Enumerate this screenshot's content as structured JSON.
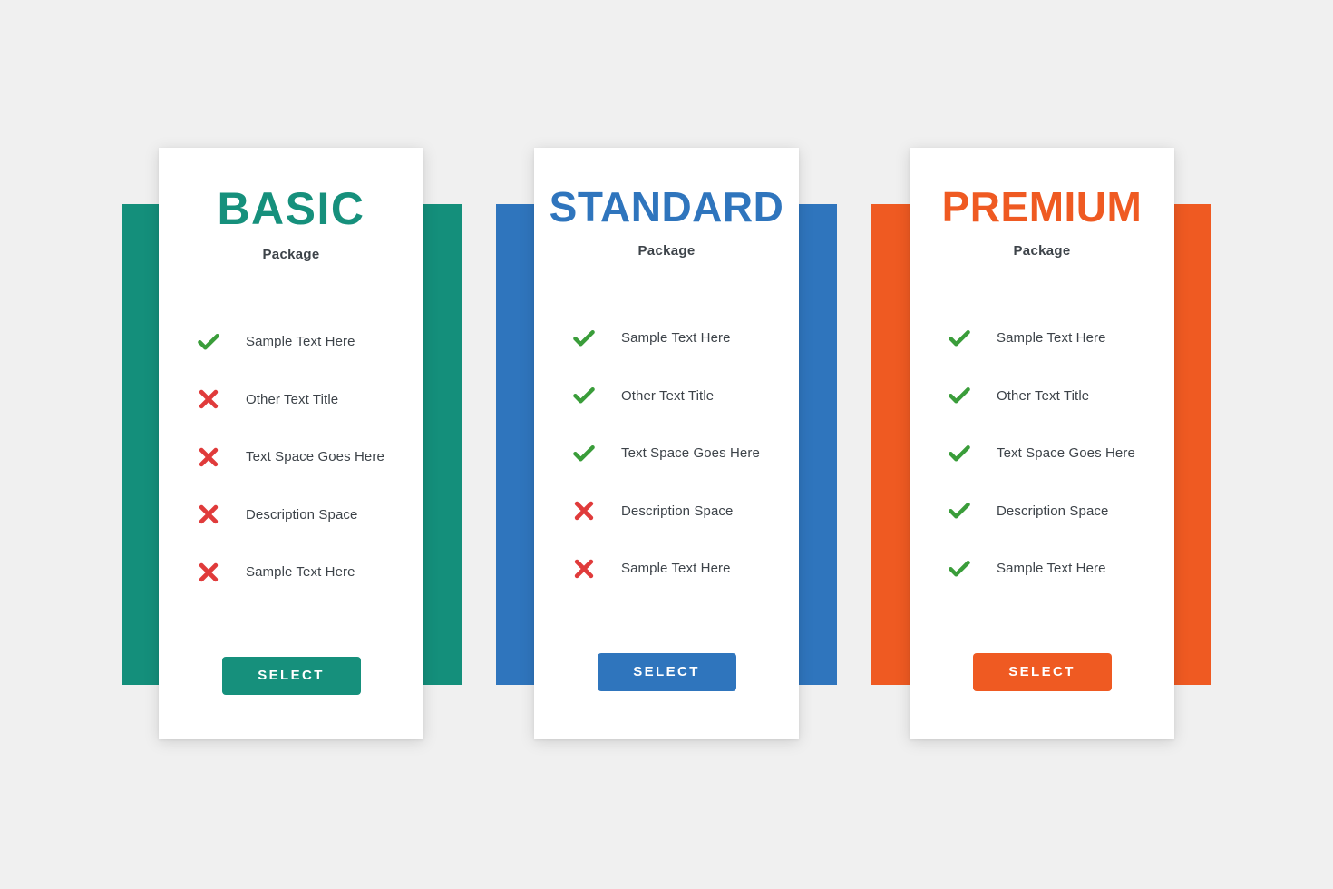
{
  "background_color": "#f0f0f0",
  "colors": {
    "teal": "#16907c",
    "blue": "#2f75bd",
    "orange": "#ef5a22",
    "check_green": "#3a9d3a",
    "cross_red": "#e03b3b",
    "text_dark": "#3d4349",
    "divider": "#e4e4e4"
  },
  "plans": [
    {
      "id": "basic",
      "title": "BASIC",
      "subtitle": "Package",
      "accent_color": "#16907c",
      "button_label": "SELECT",
      "features": [
        {
          "label": "Sample Text Here",
          "icon": "check-icon",
          "included": true
        },
        {
          "label": "Other Text Title",
          "icon": "cross-icon",
          "included": false
        },
        {
          "label": "Text Space Goes Here",
          "icon": "cross-icon",
          "included": false
        },
        {
          "label": "Description Space",
          "icon": "cross-icon",
          "included": false
        },
        {
          "label": "Sample Text Here",
          "icon": "cross-icon",
          "included": false
        }
      ]
    },
    {
      "id": "standard",
      "title": "STANDARD",
      "subtitle": "Package",
      "accent_color": "#2f75bd",
      "button_label": "SELECT",
      "features": [
        {
          "label": "Sample Text Here",
          "icon": "check-icon",
          "included": true
        },
        {
          "label": "Other Text Title",
          "icon": "check-icon",
          "included": true
        },
        {
          "label": "Text Space Goes Here",
          "icon": "check-icon",
          "included": true
        },
        {
          "label": "Description Space",
          "icon": "cross-icon",
          "included": false
        },
        {
          "label": "Sample Text Here",
          "icon": "cross-icon",
          "included": false
        }
      ]
    },
    {
      "id": "premium",
      "title": "PREMIUM",
      "subtitle": "Package",
      "accent_color": "#ef5a22",
      "button_label": "SELECT",
      "features": [
        {
          "label": "Sample Text Here",
          "icon": "check-icon",
          "included": true
        },
        {
          "label": "Other Text Title",
          "icon": "check-icon",
          "included": true
        },
        {
          "label": "Text Space Goes Here",
          "icon": "check-icon",
          "included": true
        },
        {
          "label": "Description Space",
          "icon": "check-icon",
          "included": true
        },
        {
          "label": "Sample Text Here",
          "icon": "check-icon",
          "included": true
        }
      ]
    }
  ]
}
